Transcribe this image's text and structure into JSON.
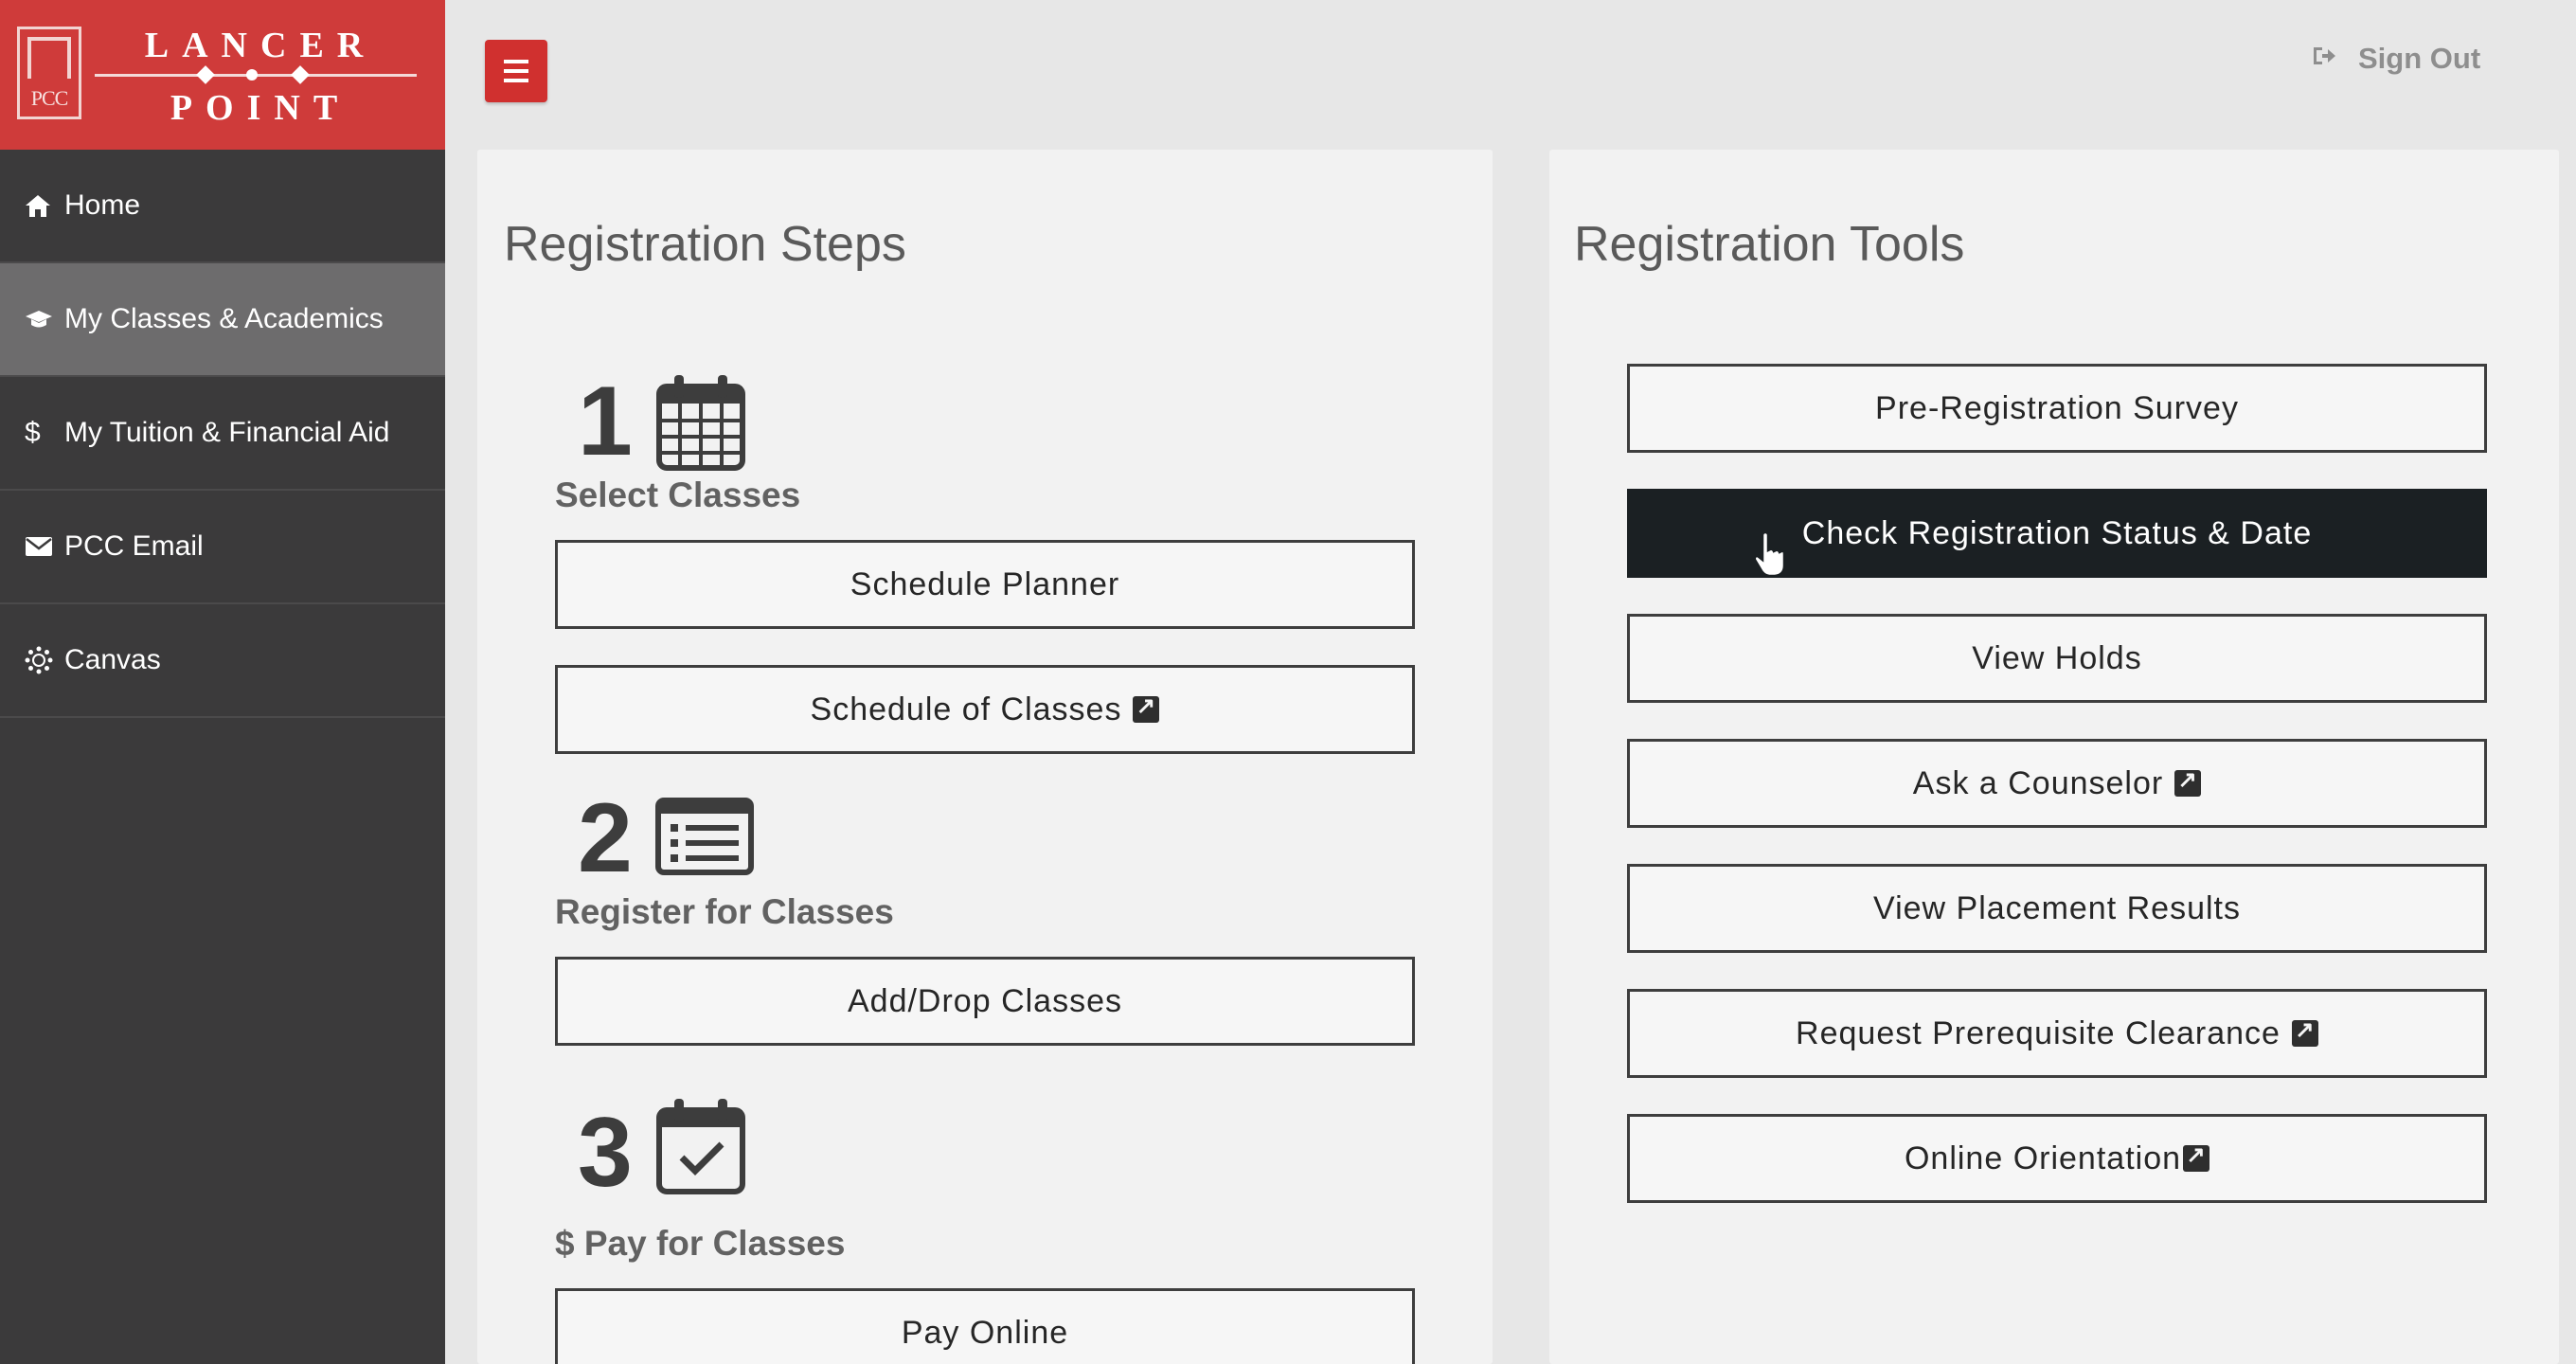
{
  "logo": {
    "top": "LANCER",
    "bottom": "POINT",
    "crest": "PCC"
  },
  "nav": [
    {
      "label": "Home",
      "icon": "home-icon",
      "active": false
    },
    {
      "label": "My Classes & Academics",
      "icon": "graduation-cap-icon",
      "active": true
    },
    {
      "label": "My Tuition & Financial Aid",
      "icon": "dollar-icon",
      "active": false
    },
    {
      "label": "PCC Email",
      "icon": "envelope-icon",
      "active": false
    },
    {
      "label": "Canvas",
      "icon": "canvas-icon",
      "active": false
    }
  ],
  "header": {
    "signout_label": "Sign Out"
  },
  "steps": {
    "title": "Registration Steps",
    "items": [
      {
        "number": "1",
        "label": "Select Classes",
        "icon": "calendar-grid-icon",
        "buttons": [
          {
            "label": "Schedule Planner",
            "external": false
          },
          {
            "label": "Schedule of Classes",
            "external": true
          }
        ]
      },
      {
        "number": "2",
        "label": "Register for Classes",
        "icon": "list-icon",
        "buttons": [
          {
            "label": "Add/Drop Classes",
            "external": false
          }
        ]
      },
      {
        "number": "3",
        "label": "$ Pay for Classes",
        "icon": "calendar-check-icon",
        "buttons": [
          {
            "label": "Pay Online",
            "external": false
          }
        ]
      }
    ]
  },
  "tools": {
    "title": "Registration Tools",
    "buttons": [
      {
        "label": "Pre-Registration Survey",
        "external": false,
        "active": false
      },
      {
        "label": "Check Registration Status & Date",
        "external": false,
        "active": true
      },
      {
        "label": "View Holds",
        "external": false,
        "active": false
      },
      {
        "label": "Ask a Counselor",
        "external": true,
        "active": false
      },
      {
        "label": "View Placement Results",
        "external": false,
        "active": false
      },
      {
        "label": "Request Prerequisite Clearance",
        "external": true,
        "active": false
      },
      {
        "label": "Online Orientation",
        "external": true,
        "active": false
      }
    ]
  },
  "colors": {
    "brand_red": "#cf3b3a",
    "sidebar": "#3b3a3b",
    "sidebar_active": "#6d6c6d",
    "active_button": "#1b2023"
  }
}
